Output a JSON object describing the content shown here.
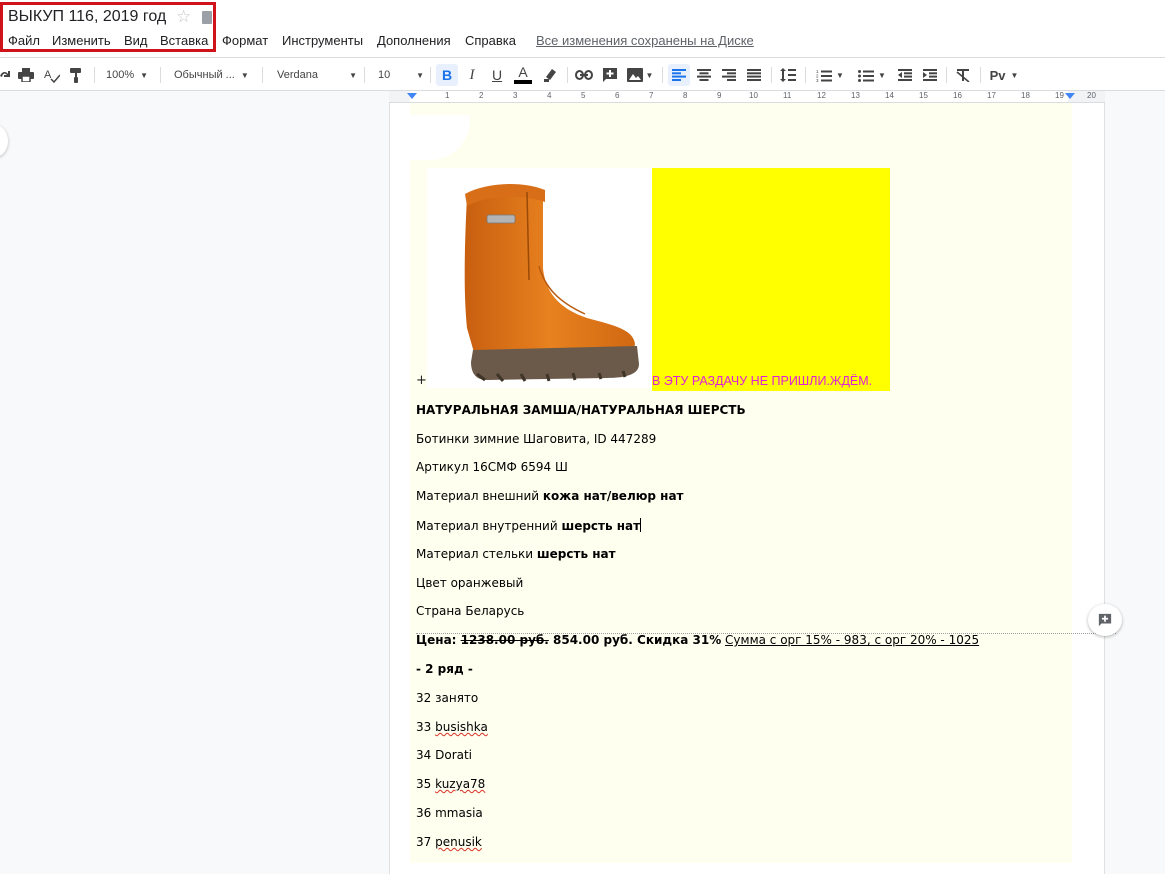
{
  "app": {
    "doc_title": "ВЫКУП 116, 2019 год",
    "saved_status": "Все изменения сохранены на Диске"
  },
  "menu": [
    "Файл",
    "Изменить",
    "Вид",
    "Вставка",
    "Формат",
    "Инструменты",
    "Дополнения",
    "Справка"
  ],
  "toolbar": {
    "zoom": "100%",
    "style": "Обычный ...",
    "font": "Verdana",
    "font_size": "10",
    "bold": "B",
    "italic": "I",
    "underline": "U",
    "text_color": "A",
    "spellcheck_label": "Рv"
  },
  "ruler": [
    "1",
    "2",
    "3",
    "4",
    "5",
    "6",
    "7",
    "8",
    "9",
    "10",
    "11",
    "12",
    "13",
    "14",
    "15",
    "16",
    "17",
    "18",
    "19",
    "20"
  ],
  "colors": {
    "highlight_box": "#d0121b",
    "caption_magenta": "#e020d8",
    "yellow_block": "#ffff00",
    "boot_orange": "#e5771e"
  },
  "document": {
    "plus": "+",
    "caption": "В ЭТУ РАЗДАЧУ НЕ ПРИШЛИ.ЖДЁМ.",
    "heading": "НАТУРАЛЬНАЯ ЗАМША/НАТУРАЛЬНАЯ ШЕРСТЬ",
    "product": "Ботинки зимние Шаговита, ID 447289",
    "article": "Артикул 16СМФ 6594 Ш",
    "material_outer_label": "Материал внешний ",
    "material_outer_value": "кожа нат/велюр нат",
    "material_inner_label": "Материал внутренний ",
    "material_inner_value": "шерсть нат",
    "insole_label": "Материал стельки ",
    "insole_value": "шерсть нат",
    "color": "Цвет оранжевый",
    "country": "Страна Беларусь",
    "price_label": "Цена: ",
    "price_old": "1238.00 руб.",
    "price_new": " 854.00 руб. Скидка 31%",
    "price_sum": "Сумма с орг 15% - 983, с орг 20% - 1025",
    "row_heading": "- 2 ряд -",
    "entries": [
      {
        "num": "32",
        "name": "занято",
        "link": false
      },
      {
        "num": "33",
        "name": "busishka",
        "link": true
      },
      {
        "num": "34",
        "name": "Dorati",
        "link": false
      },
      {
        "num": "35",
        "name": "kuzya78",
        "link": true
      },
      {
        "num": "36",
        "name": "mmasia",
        "link": false
      },
      {
        "num": "37",
        "name": "penusik",
        "link": true
      }
    ]
  }
}
